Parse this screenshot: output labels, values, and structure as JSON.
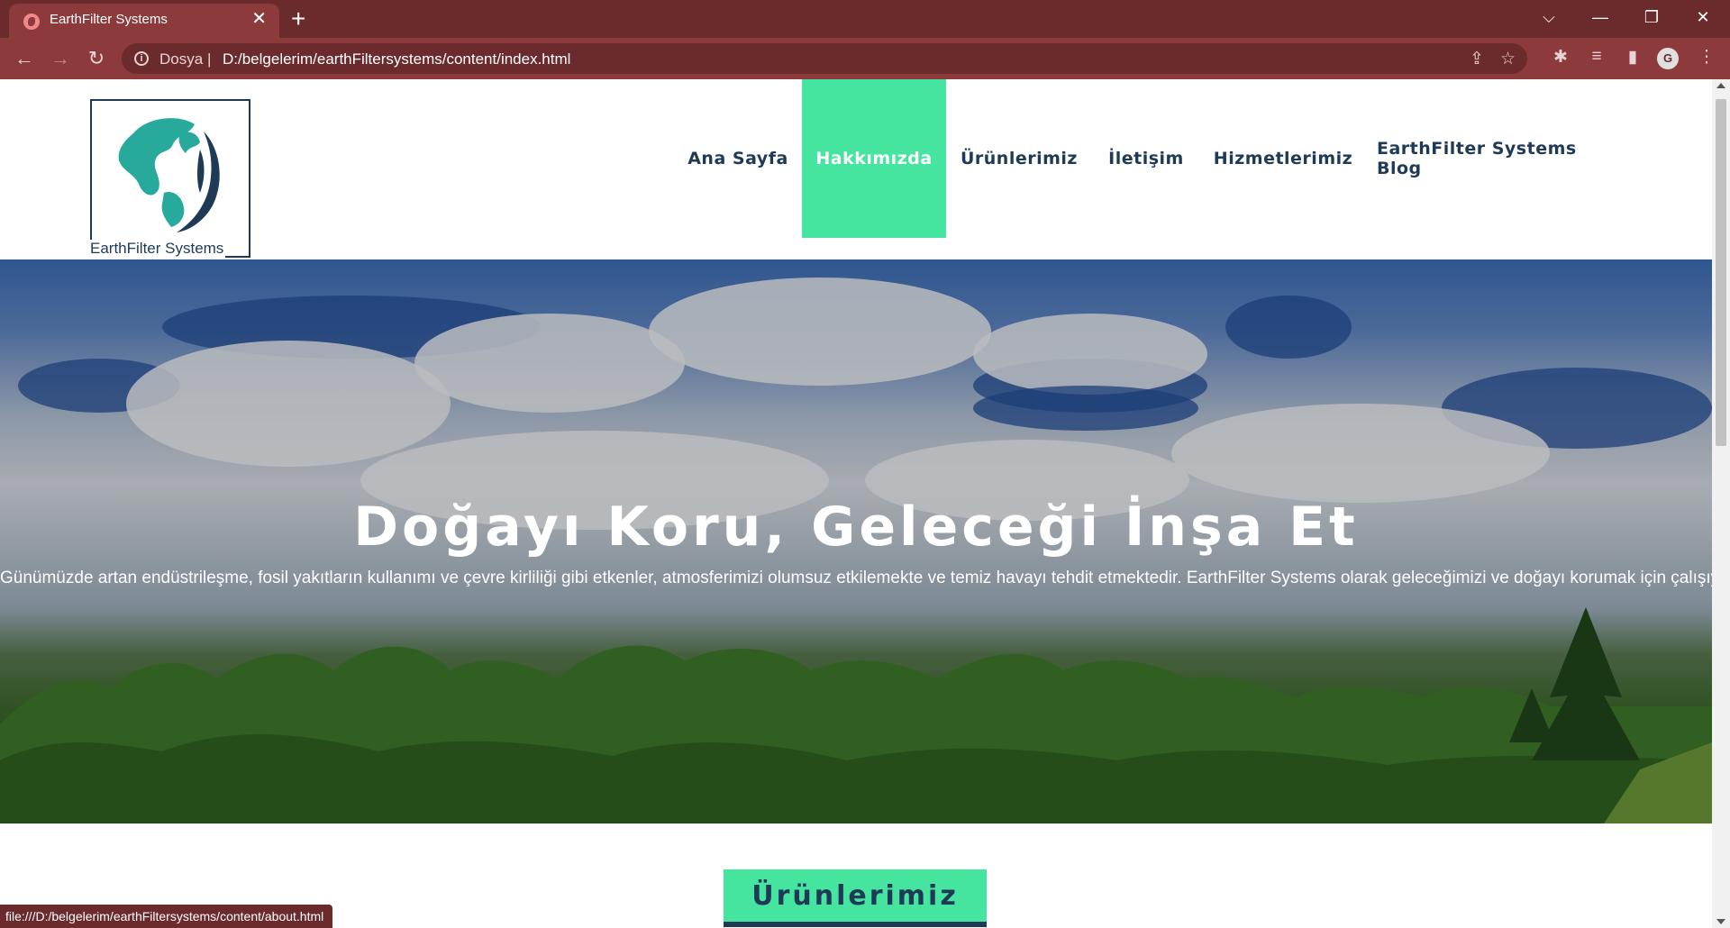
{
  "browser": {
    "tab_title": "EarthFilter Systems",
    "tab_close": "✕",
    "new_tab": "+",
    "window_controls": {
      "tab_search": "⌵",
      "minimize": "—",
      "restore": "❐",
      "close": "✕"
    },
    "nav_buttons": {
      "back": "←",
      "forward": "→",
      "reload": "↻"
    },
    "address": {
      "scheme_label": "Dosya",
      "separator": "|",
      "url": "D:/belgelerim/earthFiltersystems/content/index.html",
      "info_icon": "i"
    },
    "omnibox_icons": {
      "share": "⇪",
      "bookmark": "☆"
    },
    "toolbar_icons": {
      "extensions": "✱",
      "media": "≡",
      "side_panel": "▮",
      "menu": "⋮"
    },
    "profile_initial": "G",
    "status_url": "file:///D:/belgelerim/earthFiltersystems/content/about.html"
  },
  "header": {
    "logo_text": "EarthFilter Systems",
    "nav": [
      {
        "label": "Ana Sayfa",
        "active": false
      },
      {
        "label": "Hakkımızda",
        "active": true
      },
      {
        "label": "Ürünlerimiz",
        "active": false
      },
      {
        "label": "İletişim",
        "active": false
      },
      {
        "label": "Hizmetlerimiz",
        "active": false
      },
      {
        "label": "EarthFilter Systems Blog",
        "active": false
      }
    ]
  },
  "hero": {
    "title": "Doğayı Koru, Geleceği İnşa Et",
    "subtitle": "Günümüzde artan endüstrileşme, fosil yakıtların kullanımı ve çevre kirliliği gibi etkenler, atmosferimizi olumsuz etkilemekte ve temiz havayı tehdit etmektedir. EarthFilter Systems olarak geleceğimizi ve doğayı korumak için çalışıyoruz."
  },
  "products": {
    "heading": "Ürünlerimiz"
  },
  "colors": {
    "accent": "#45e59f",
    "navy": "#1e3a57",
    "chrome_dark": "#6b2a2c",
    "chrome": "#8c3a3c"
  }
}
